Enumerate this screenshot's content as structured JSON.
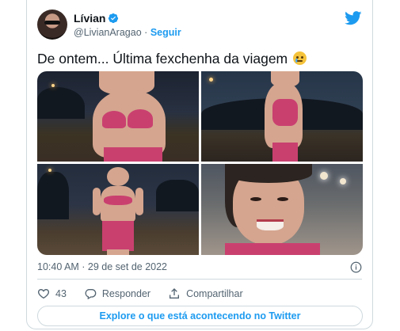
{
  "tweet": {
    "author_name": "Lívian",
    "handle": "@LivianAragao",
    "separator": "·",
    "follow_label": "Seguir",
    "text": "De ontem... Última fexchenha da viagem",
    "timestamp": "10:40 AM · 29 de set de 2022",
    "likes_count": "43",
    "reply_label": "Responder",
    "share_label": "Compartilhar",
    "explore_label": "Explore o que está acontecendo no Twitter"
  },
  "icons": {
    "verified": "verified-badge-icon",
    "logo": "twitter-bird-icon",
    "info": "info-icon",
    "like": "heart-icon",
    "reply": "reply-bubble-icon",
    "share": "share-upload-icon",
    "emoji": "face-holding-back-tears-emoji"
  },
  "colors": {
    "accent": "#1d9bf0",
    "text_primary": "#0f1419",
    "text_secondary": "#536471",
    "border": "#cfd9de"
  }
}
